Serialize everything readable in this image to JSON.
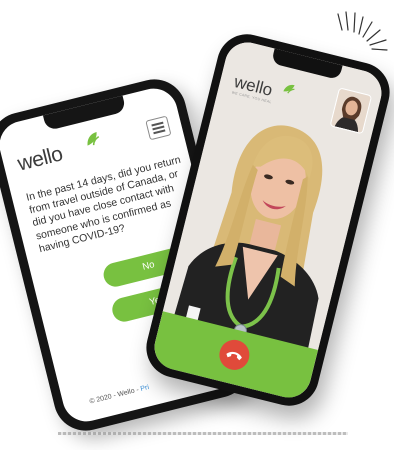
{
  "brand": {
    "name": "wello",
    "tagline": "WE CARE, YOU HEAL",
    "accent": "#78c140",
    "hangup_color": "#e04a3a"
  },
  "form_phone": {
    "question": "In the past 14 days, did you return from travel outside of Canada, or did you have close contact with someone who is confirmed as having COVID-19?",
    "buttons": {
      "no": "No",
      "yes": "Yes"
    },
    "menu_icon": "hamburger-icon",
    "footer_copyright": "© 2020 - Wello -",
    "footer_link": "Pri"
  },
  "video_phone": {
    "call_control_icon": "hang-up-phone-icon",
    "self_view_icon": "self-view-thumbnail",
    "participant": "doctor-video-feed"
  }
}
